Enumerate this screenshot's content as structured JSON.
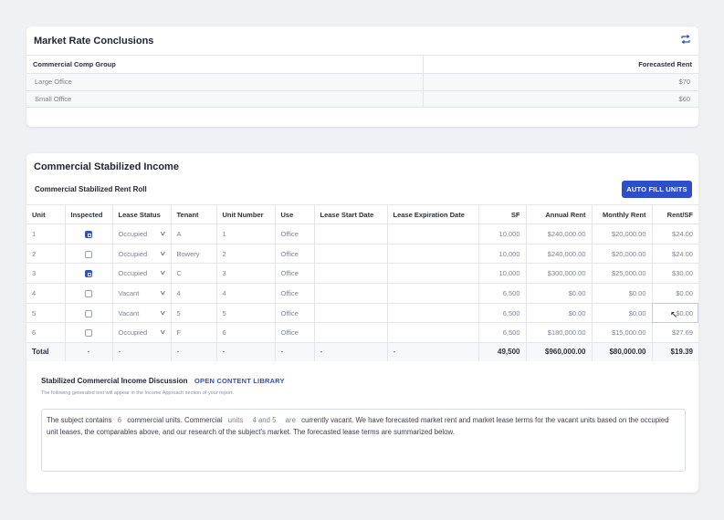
{
  "market": {
    "title": "Market Rate Conclusions",
    "columns": [
      "Commercial Comp Group",
      "Forecasted Rent"
    ],
    "rows": [
      {
        "group": "Large Office",
        "rent": "$70"
      },
      {
        "group": "Small Office",
        "rent": "$60"
      }
    ]
  },
  "income": {
    "title": "Commercial Stabilized Income",
    "subtitle": "Commercial Stabilized Rent Roll",
    "autofill_label": "AUTO FILL UNITS",
    "columns": [
      "Unit",
      "Inspected",
      "Lease Status",
      "Tenant",
      "Unit Number",
      "Use",
      "Lease Start Date",
      "Lease Expiration Date",
      "SF",
      "Annual Rent",
      "Monthly Rent",
      "Rent/SF"
    ],
    "rows": [
      {
        "unit": "1",
        "inspected": true,
        "status": "Occupied",
        "tenant": "A",
        "unit_number": "1",
        "use": "Office",
        "start": "",
        "expiration": "",
        "sf": "10,000",
        "annual": "$240,000.00",
        "monthly": "$20,000.00",
        "rent_sf": "$24.00"
      },
      {
        "unit": "2",
        "inspected": false,
        "status": "Occupied",
        "tenant": "Bowery",
        "unit_number": "2",
        "use": "Office",
        "start": "",
        "expiration": "",
        "sf": "10,000",
        "annual": "$240,000.00",
        "monthly": "$20,000.00",
        "rent_sf": "$24.00"
      },
      {
        "unit": "3",
        "inspected": true,
        "status": "Occupied",
        "tenant": "C",
        "unit_number": "3",
        "use": "Office",
        "start": "",
        "expiration": "",
        "sf": "10,000",
        "annual": "$300,000.00",
        "monthly": "$25,000.00",
        "rent_sf": "$30.00"
      },
      {
        "unit": "4",
        "inspected": false,
        "status": "Vacant",
        "tenant": "4",
        "unit_number": "4",
        "use": "Office",
        "start": "",
        "expiration": "",
        "sf": "6,500",
        "annual": "$0.00",
        "monthly": "$0.00",
        "rent_sf": "$0.00"
      },
      {
        "unit": "5",
        "inspected": false,
        "status": "Vacant",
        "tenant": "5",
        "unit_number": "5",
        "use": "Office",
        "start": "",
        "expiration": "",
        "sf": "6,500",
        "annual": "$0.00",
        "monthly": "$0.00",
        "rent_sf": "$0.00"
      },
      {
        "unit": "6",
        "inspected": false,
        "status": "Occupied",
        "tenant": "F",
        "unit_number": "6",
        "use": "Office",
        "start": "",
        "expiration": "",
        "sf": "6,500",
        "annual": "$180,000.00",
        "monthly": "$15,000.00",
        "rent_sf": "$27.69"
      }
    ],
    "total": {
      "label": "Total",
      "dash": "-",
      "sf": "49,500",
      "annual": "$960,000.00",
      "monthly": "$80,000.00",
      "rent_sf": "$19.39"
    }
  },
  "discussion": {
    "title": "Stabilized Commercial Income Discussion",
    "link": "OPEN CONTENT LIBRARY",
    "note": "The following generated text will appear in the Income Approach section of your report.",
    "text": {
      "p1": "The subject contains",
      "t1": "6",
      "p2": "commercial units. Commercial",
      "t2": "units",
      "t3": "4 and 5",
      "t4": "are",
      "p3": "currently vacant. We have forecasted market rent and market lease terms for the vacant units based on the occupied unit leases, the comparables above, and our research of the subject's market. The forecasted lease terms are summarized below."
    }
  },
  "icons": {
    "refresh": "refresh-icon",
    "chevron": "chevron-down-icon"
  },
  "colors": {
    "accent": "#2f4fc9"
  }
}
